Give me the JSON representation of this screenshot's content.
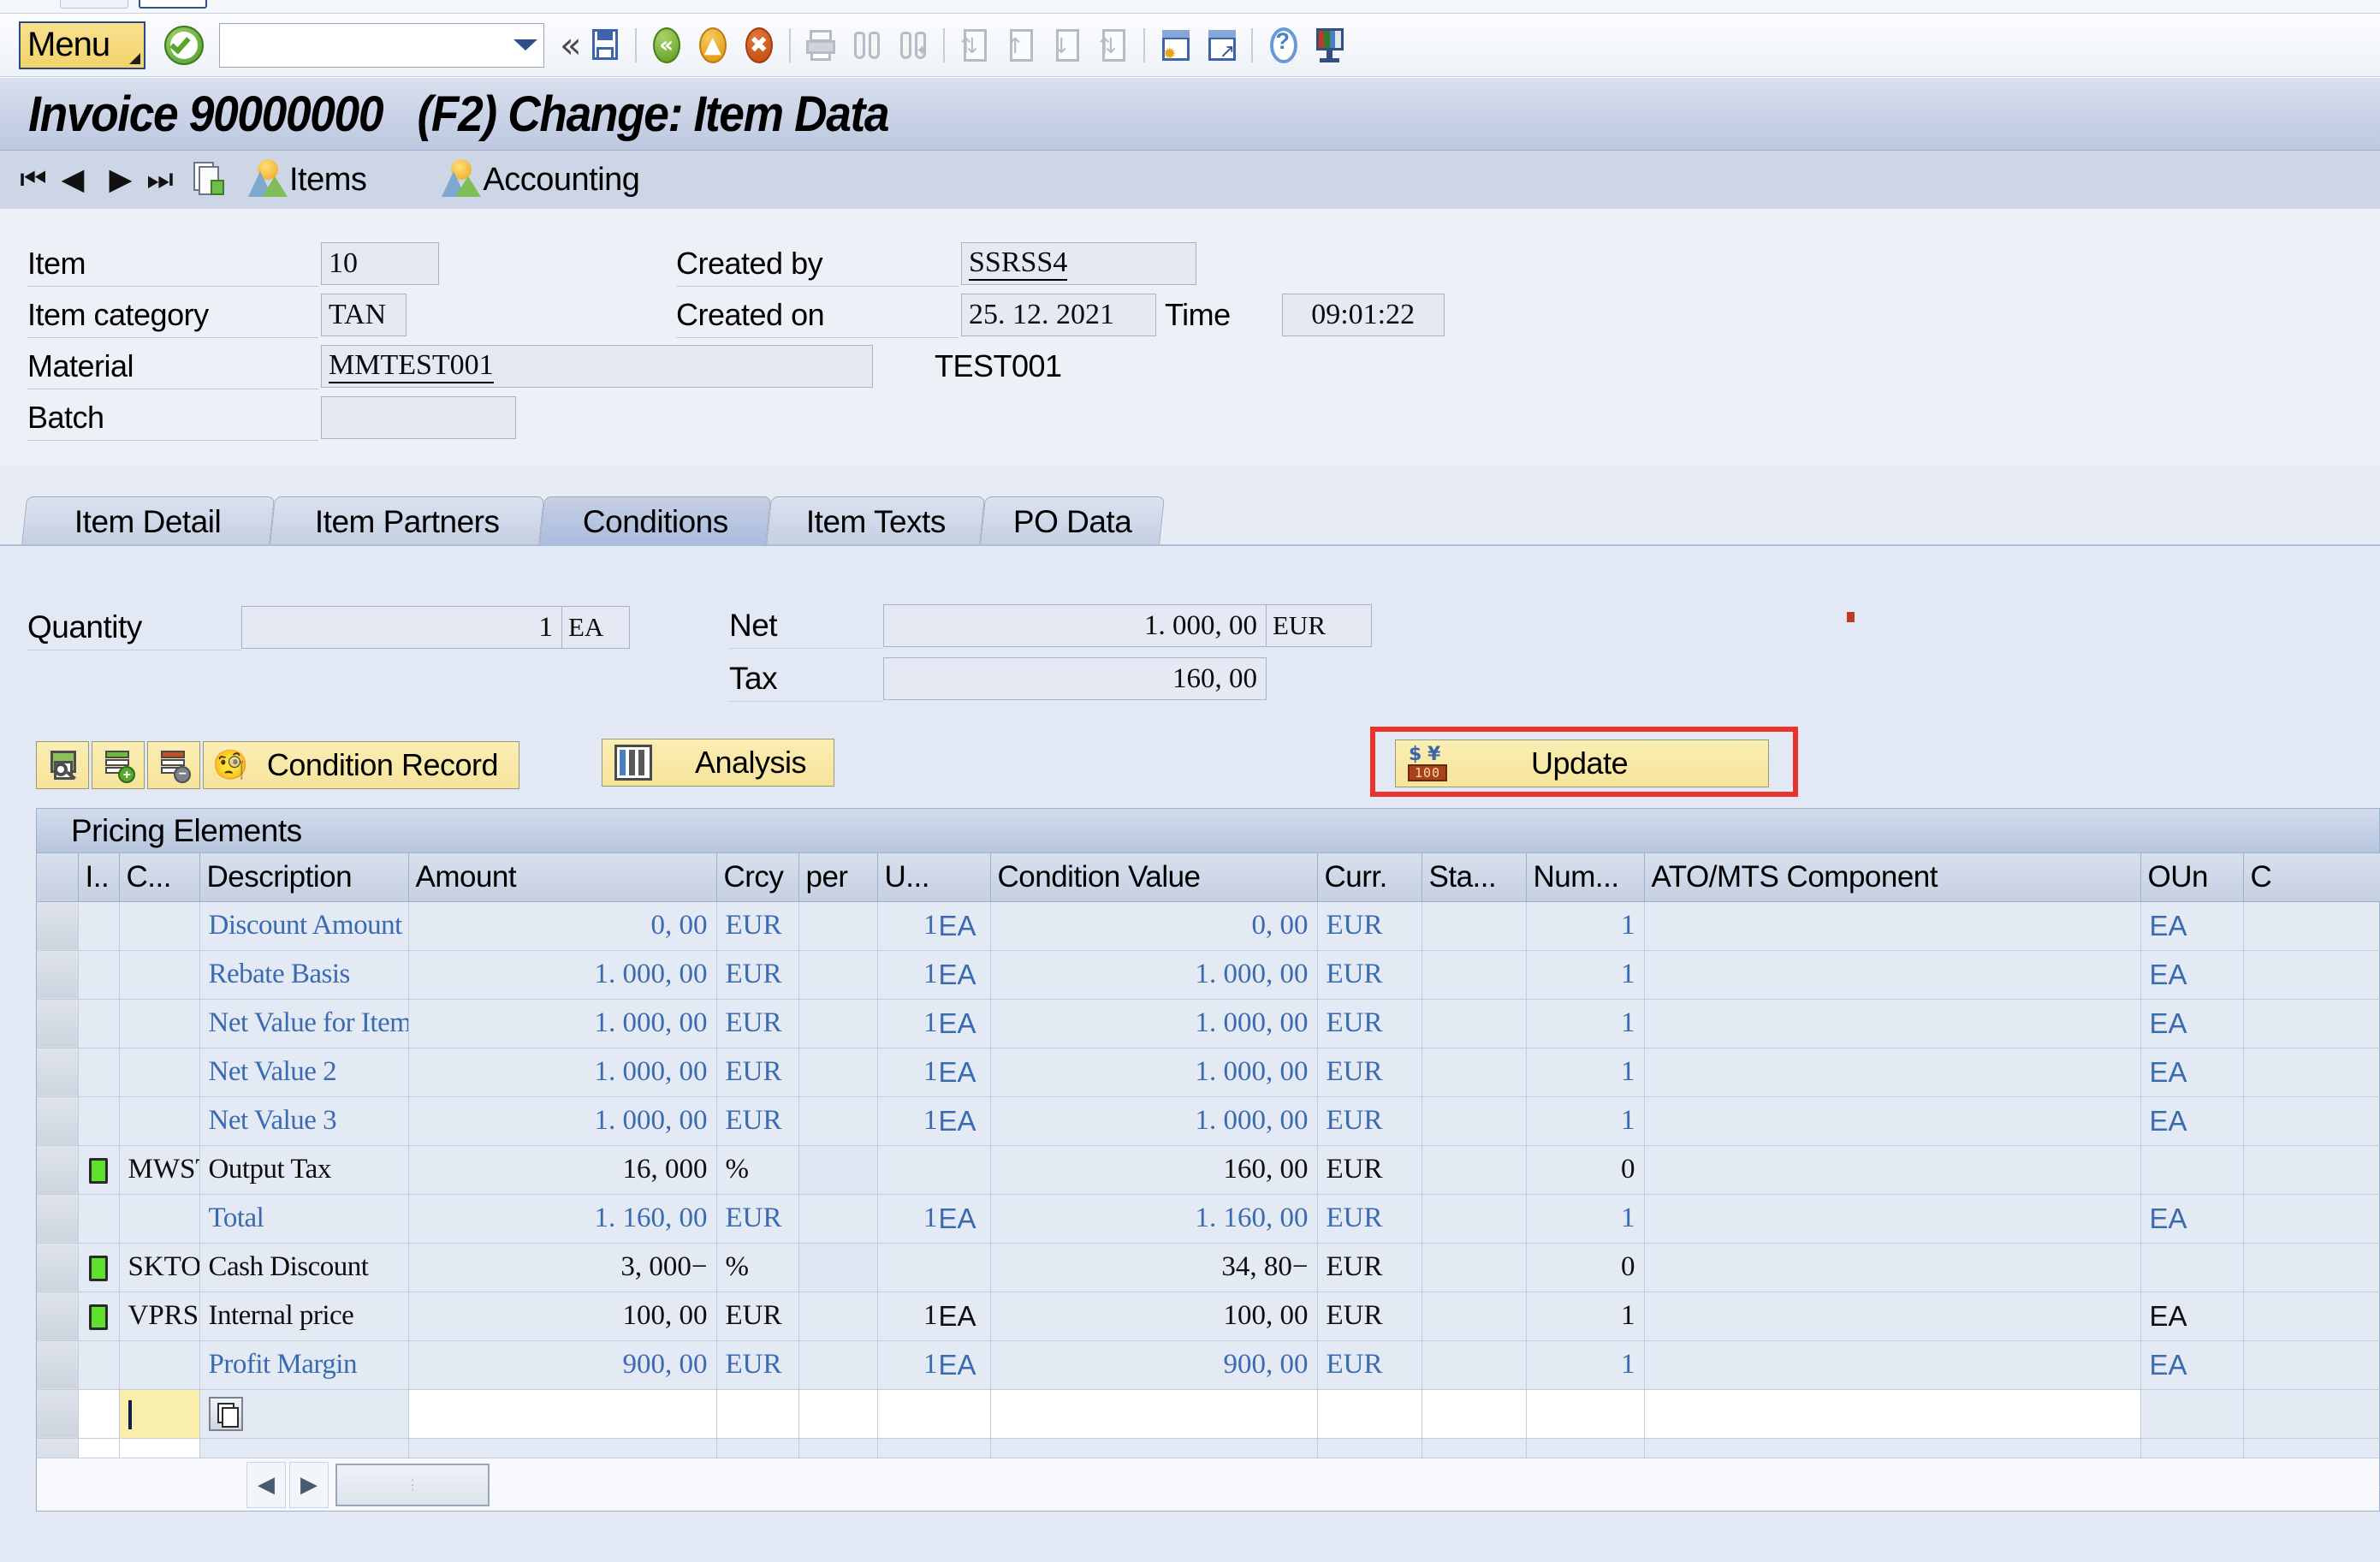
{
  "toolbar": {
    "menu_label": "Menu",
    "command_value": "",
    "command_placeholder": "",
    "icons": [
      "enter-check-icon",
      "command-dropdown-icon",
      "collapse-icon",
      "save-icon",
      "back-icon",
      "exit-icon",
      "cancel-icon",
      "print-icon",
      "find-icon",
      "find-next-icon",
      "first-page-icon",
      "previous-page-icon",
      "next-page-icon",
      "last-page-icon",
      "create-session-icon",
      "create-shortcut-icon",
      "help-icon",
      "customize-layout-icon"
    ]
  },
  "title": "Invoice 90000000   (F2) Change: Item Data",
  "appbar": {
    "first_label": "⏮",
    "prev_label": "◀",
    "next_label": "▶",
    "last_label": "⏭",
    "items_label": "Items",
    "accounting_label": "Accounting"
  },
  "header": {
    "item_label": "Item",
    "item_value": "10",
    "item_category_label": "Item category",
    "item_category_value": "TAN",
    "material_label": "Material",
    "material_value": "MMTEST001",
    "material_desc": "TEST001",
    "batch_label": "Batch",
    "batch_value": "",
    "created_by_label": "Created by",
    "created_by_value": "SSRSS4",
    "created_on_label": "Created on",
    "created_on_value": "25. 12. 2021",
    "time_label": "Time",
    "time_value": "09:01:22"
  },
  "tabs": [
    {
      "label": "Item Detail",
      "active": false
    },
    {
      "label": "Item Partners",
      "active": false
    },
    {
      "label": "Conditions",
      "active": true
    },
    {
      "label": "Item Texts",
      "active": false
    },
    {
      "label": "PO Data",
      "active": false
    }
  ],
  "conditions": {
    "quantity_label": "Quantity",
    "quantity_value": "1",
    "quantity_unit": "EA",
    "net_label": "Net",
    "net_value": "1. 000, 00",
    "net_currency": "EUR",
    "tax_label": "Tax",
    "tax_value": "160, 00"
  },
  "buttons": {
    "condition_record_label": "Condition Record",
    "analysis_label": "Analysis",
    "update_label": "Update",
    "update_highlighted": true,
    "highlight_color": "#e8342a"
  },
  "table": {
    "title": "Pricing Elements",
    "columns": [
      "",
      "I..",
      "C...",
      "Description",
      "Amount",
      "Crcy",
      "per",
      "U...",
      "Condition Value",
      "Curr.",
      "Sta...",
      "Num...",
      "ATO/MTS Component",
      "OUn",
      "C"
    ],
    "rows": [
      {
        "status": "",
        "cond": "",
        "desc": "Discount Amount",
        "amount": "0, 00",
        "crcy": "EUR",
        "per": "1",
        "u": "EA",
        "cond_value": "0, 00",
        "curr": "EUR",
        "sta": "",
        "num": "1",
        "ato": "",
        "oun": "EA",
        "style": "blue"
      },
      {
        "status": "",
        "cond": "",
        "desc": "Rebate Basis",
        "amount": "1. 000, 00",
        "crcy": "EUR",
        "per": "1",
        "u": "EA",
        "cond_value": "1. 000, 00",
        "curr": "EUR",
        "sta": "",
        "num": "1",
        "ato": "",
        "oun": "EA",
        "style": "blue"
      },
      {
        "status": "",
        "cond": "",
        "desc": "Net Value for Item",
        "amount": "1. 000, 00",
        "crcy": "EUR",
        "per": "1",
        "u": "EA",
        "cond_value": "1. 000, 00",
        "curr": "EUR",
        "sta": "",
        "num": "1",
        "ato": "",
        "oun": "EA",
        "style": "blue"
      },
      {
        "status": "",
        "cond": "",
        "desc": "Net Value 2",
        "amount": "1. 000, 00",
        "crcy": "EUR",
        "per": "1",
        "u": "EA",
        "cond_value": "1. 000, 00",
        "curr": "EUR",
        "sta": "",
        "num": "1",
        "ato": "",
        "oun": "EA",
        "style": "blue"
      },
      {
        "status": "",
        "cond": "",
        "desc": "Net Value 3",
        "amount": "1. 000, 00",
        "crcy": "EUR",
        "per": "1",
        "u": "EA",
        "cond_value": "1. 000, 00",
        "curr": "EUR",
        "sta": "",
        "num": "1",
        "ato": "",
        "oun": "EA",
        "style": "blue"
      },
      {
        "status": "green",
        "cond": "MWST",
        "desc": "Output Tax",
        "amount": "16, 000",
        "crcy": "%",
        "per": "",
        "u": "",
        "cond_value": "160, 00",
        "curr": "EUR",
        "sta": "",
        "num": "0",
        "ato": "",
        "oun": "",
        "style": "black",
        "value_blue": true
      },
      {
        "status": "",
        "cond": "",
        "desc": "Total",
        "amount": "1. 160, 00",
        "crcy": "EUR",
        "per": "1",
        "u": "EA",
        "cond_value": "1. 160, 00",
        "curr": "EUR",
        "sta": "",
        "num": "1",
        "ato": "",
        "oun": "EA",
        "style": "blue"
      },
      {
        "status": "green",
        "cond": "SKTO",
        "desc": "Cash Discount",
        "amount": "3, 000−",
        "crcy": "%",
        "per": "",
        "u": "",
        "cond_value": "34, 80−",
        "curr": "EUR",
        "sta": "",
        "num": "0",
        "ato": "",
        "oun": "",
        "style": "black"
      },
      {
        "status": "green",
        "cond": "VPRS",
        "desc": "Internal price",
        "amount": "100, 00",
        "crcy": "EUR",
        "per": "1",
        "u": "EA",
        "cond_value": "100, 00",
        "curr": "EUR",
        "sta": "",
        "num": "1",
        "ato": "",
        "oun": "EA",
        "style": "black"
      },
      {
        "status": "",
        "cond": "",
        "desc": "Profit Margin",
        "amount": "900, 00",
        "crcy": "EUR",
        "per": "1",
        "u": "EA",
        "cond_value": "900, 00",
        "curr": "EUR",
        "sta": "",
        "num": "1",
        "ato": "",
        "oun": "EA",
        "style": "blue"
      }
    ],
    "entry_row": {
      "editing": true,
      "value": ""
    },
    "empty_row": {
      "value": ""
    },
    "scroll_left_label": "◀",
    "scroll_right_label": "▶"
  }
}
